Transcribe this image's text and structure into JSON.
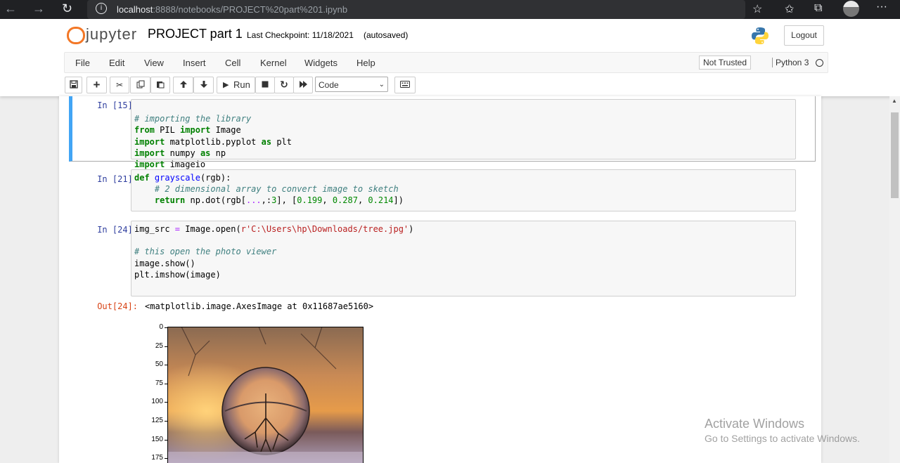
{
  "browser": {
    "url_host": "localhost",
    "url_path": ":8888/notebooks/PROJECT%20part%201.ipynb"
  },
  "header": {
    "logo_text": "jupyter",
    "notebook_title": "PROJECT part 1",
    "checkpoint": "Last Checkpoint: 11/18/2021",
    "autosave": "(autosaved)",
    "logout_label": "Logout"
  },
  "menu": {
    "items": [
      "File",
      "Edit",
      "View",
      "Insert",
      "Cell",
      "Kernel",
      "Widgets",
      "Help"
    ],
    "trust_label": "Not Trusted",
    "kernel_name": "Python 3"
  },
  "toolbar": {
    "run_label": "Run",
    "cell_type": "Code"
  },
  "cells": [
    {
      "prompt": "In [15]:",
      "code": "# importing the library\nfrom PIL import Image\nimport matplotlib.pyplot as plt\nimport numpy as np\nimport imageio"
    },
    {
      "prompt": "In [21]:",
      "code": "def grayscale(rgb):\n    # 2 dimensional array to convert image to sketch\n    return np.dot(rgb[...,:3], [0.199, 0.287, 0.214])"
    },
    {
      "prompt": "In [24]:",
      "code": "img_src = Image.open(r'C:\\Users\\hp\\Downloads/tree.jpg')\n\n# this open the photo viewer\nimage.show()\nplt.imshow(image)"
    }
  ],
  "output": {
    "prompt": "Out[24]:",
    "text": "<matplotlib.image.AxesImage at 0x11687ae5160>",
    "yticks": [
      "0",
      "25",
      "50",
      "75",
      "100",
      "125",
      "150",
      "175"
    ]
  },
  "watermark": {
    "line1": "Activate Windows",
    "line2": "Go to Settings to activate Windows."
  }
}
